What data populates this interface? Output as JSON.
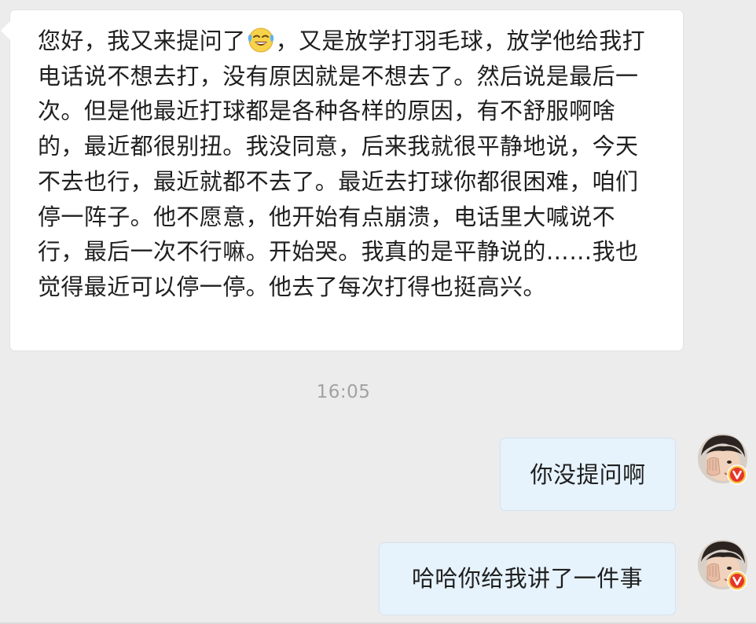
{
  "messages": {
    "incoming": {
      "text_before_emoji": "您好，我又来提问了",
      "emoji": "laugh-crying-emoji",
      "text_after_emoji": "，又是放学打羽毛球，放学他给我打电话说不想去打，没有原因就是不想去了。然后说是最后一次。但是他最近打球都是各种各样的原因，有不舒服啊啥的，最近都很别扭。我没同意，后来我就很平静地说，今天不去也行，最近就都不去了。最近去打球你都很困难，咱们停一阵子。他不愿意，他开始有点崩溃，电话里大喊说不行，最后一次不行嘛。开始哭。我真的是平静说的……我也觉得最近可以停一停。他去了每次打得也挺高兴。"
    },
    "timestamp": "16:05",
    "outgoing": [
      {
        "text": "你没提问啊",
        "avatar_icon": "user-avatar",
        "badge_icon": "verified-v-badge-icon"
      },
      {
        "text": "哈哈你给我讲了一件事",
        "avatar_icon": "user-avatar",
        "badge_icon": "verified-v-badge-icon"
      }
    ]
  },
  "colors": {
    "background": "#ececec",
    "incoming_bubble": "#ffffff",
    "outgoing_bubble": "#e6f2fc",
    "timestamp_text": "#a2a2a2",
    "badge": "#e5352b"
  }
}
